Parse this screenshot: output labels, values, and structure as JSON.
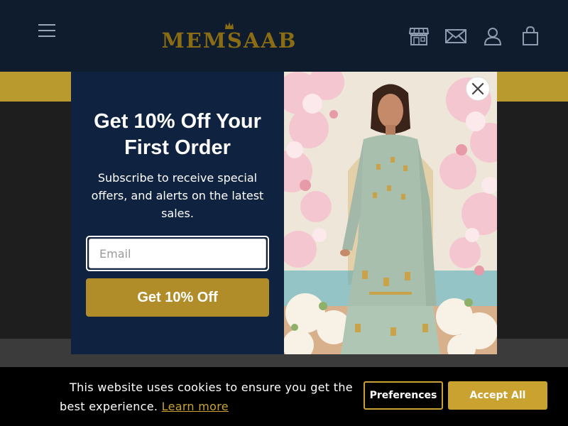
{
  "header": {
    "logo_text": "MEMSAAB",
    "icons": [
      "hamburger-menu-icon",
      "store-icon",
      "mail-icon",
      "user-icon",
      "shopping-bag-icon"
    ]
  },
  "popup": {
    "headline": "Get 10% Off Your First Order",
    "subtext": "Subscribe to receive special offers, and alerts on the latest sales.",
    "email_placeholder": "Email",
    "email_value": "",
    "cta_label": "Get 10% Off",
    "close_icon": "close-icon"
  },
  "cookie_banner": {
    "message": "This website uses cookies to ensure you get the best experience.",
    "learn_more": "Learn more",
    "preferences_label": "Preferences",
    "accept_label": "Accept All"
  },
  "colors": {
    "header_bg": "#0f1c2e",
    "brand_gold": "#b99a2e",
    "popup_bg": "#0f2240",
    "cta_bg": "#b18d2a",
    "cookie_accent": "#c9a230"
  }
}
